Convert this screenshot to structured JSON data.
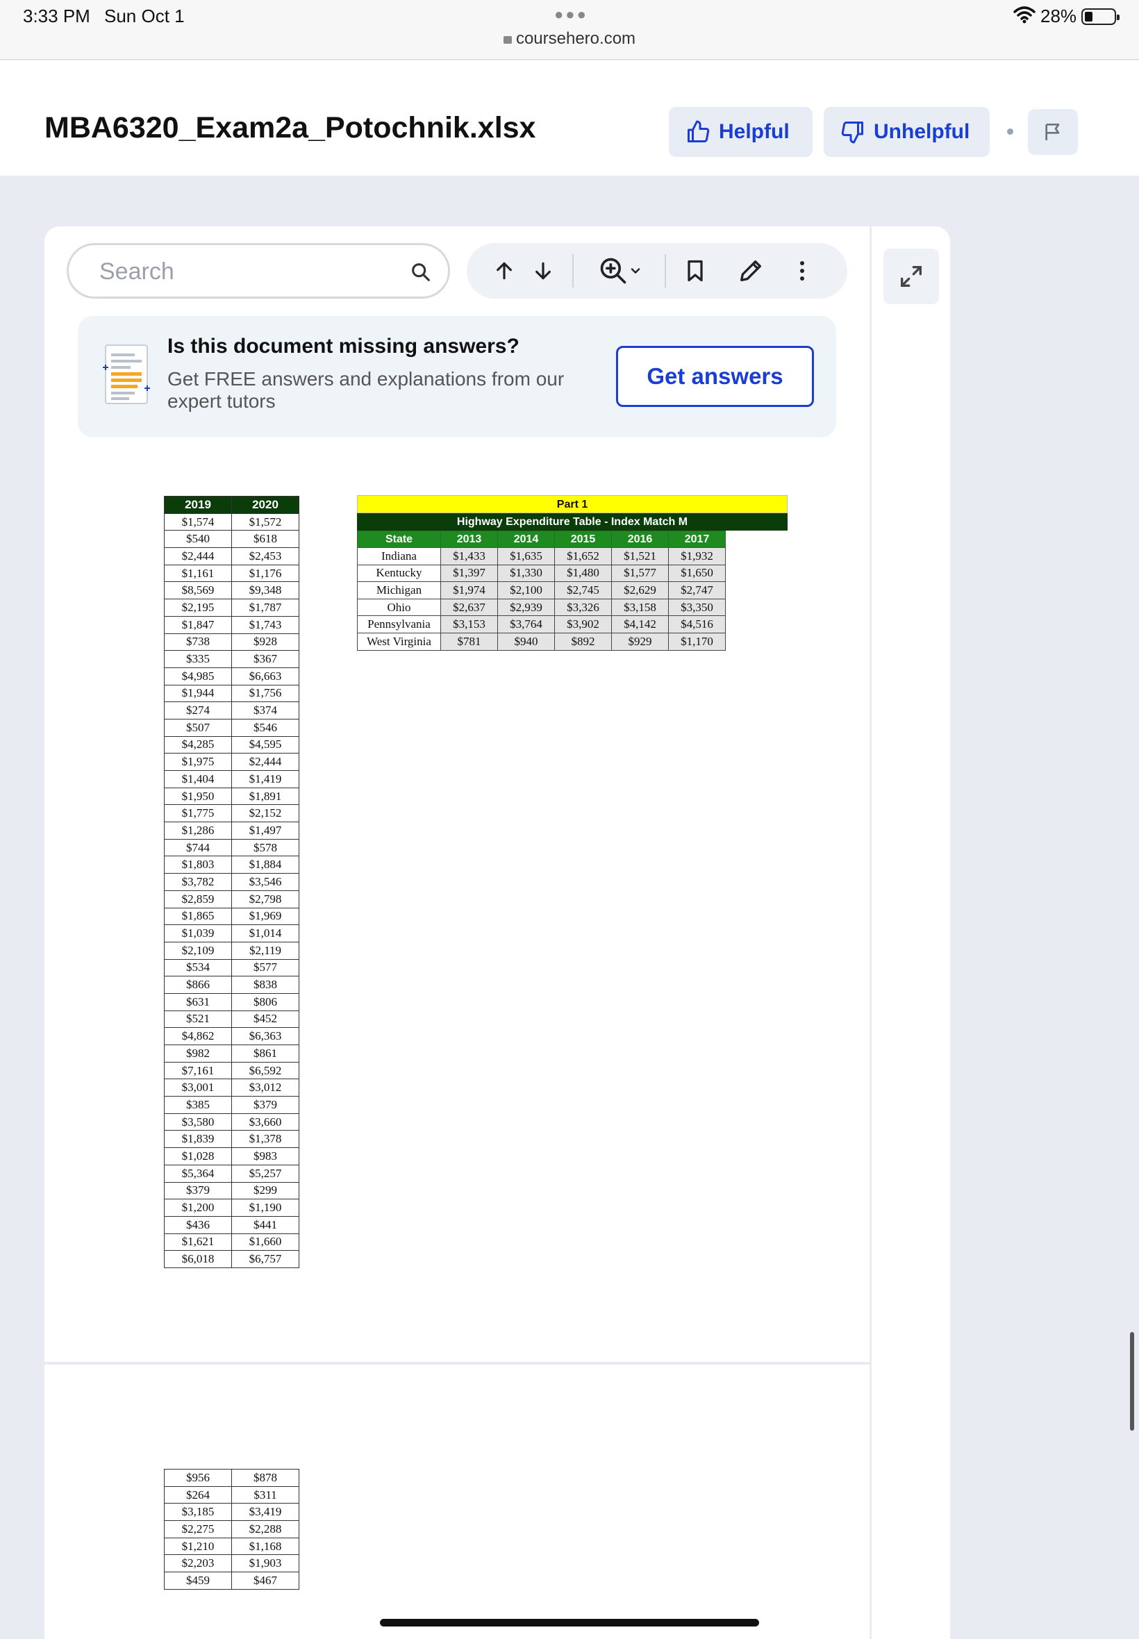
{
  "status_bar": {
    "time": "3:33 PM",
    "date": "Sun Oct 1",
    "url": "coursehero.com",
    "battery": "28%"
  },
  "header": {
    "title": "MBA6320_Exam2a_Potochnik.xlsx",
    "helpful": "Helpful",
    "unhelpful": "Unhelpful"
  },
  "search": {
    "placeholder": "Search"
  },
  "banner": {
    "title": "Is this document missing answers?",
    "text": "Get FREE answers and explanations from our expert tutors",
    "button": "Get answers"
  },
  "year_table": {
    "headers": [
      "2019",
      "2020"
    ],
    "rows": [
      [
        "$1,574",
        "$1,572"
      ],
      [
        "$540",
        "$618"
      ],
      [
        "$2,444",
        "$2,453"
      ],
      [
        "$1,161",
        "$1,176"
      ],
      [
        "$8,569",
        "$9,348"
      ],
      [
        "$2,195",
        "$1,787"
      ],
      [
        "$1,847",
        "$1,743"
      ],
      [
        "$738",
        "$928"
      ],
      [
        "$335",
        "$367"
      ],
      [
        "$4,985",
        "$6,663"
      ],
      [
        "$1,944",
        "$1,756"
      ],
      [
        "$274",
        "$374"
      ],
      [
        "$507",
        "$546"
      ],
      [
        "$4,285",
        "$4,595"
      ],
      [
        "$1,975",
        "$2,444"
      ],
      [
        "$1,404",
        "$1,419"
      ],
      [
        "$1,950",
        "$1,891"
      ],
      [
        "$1,775",
        "$2,152"
      ],
      [
        "$1,286",
        "$1,497"
      ],
      [
        "$744",
        "$578"
      ],
      [
        "$1,803",
        "$1,884"
      ],
      [
        "$3,782",
        "$3,546"
      ],
      [
        "$2,859",
        "$2,798"
      ],
      [
        "$1,865",
        "$1,969"
      ],
      [
        "$1,039",
        "$1,014"
      ],
      [
        "$2,109",
        "$2,119"
      ],
      [
        "$534",
        "$577"
      ],
      [
        "$866",
        "$838"
      ],
      [
        "$631",
        "$806"
      ],
      [
        "$521",
        "$452"
      ],
      [
        "$4,862",
        "$6,363"
      ],
      [
        "$982",
        "$861"
      ],
      [
        "$7,161",
        "$6,592"
      ],
      [
        "$3,001",
        "$3,012"
      ],
      [
        "$385",
        "$379"
      ],
      [
        "$3,580",
        "$3,660"
      ],
      [
        "$1,839",
        "$1,378"
      ],
      [
        "$1,028",
        "$983"
      ],
      [
        "$5,364",
        "$5,257"
      ],
      [
        "$379",
        "$299"
      ],
      [
        "$1,200",
        "$1,190"
      ],
      [
        "$436",
        "$441"
      ],
      [
        "$1,621",
        "$1,660"
      ],
      [
        "$6,018",
        "$6,757"
      ]
    ],
    "rows_page2": [
      [
        "$956",
        "$878"
      ],
      [
        "$264",
        "$311"
      ],
      [
        "$3,185",
        "$3,419"
      ],
      [
        "$2,275",
        "$2,288"
      ],
      [
        "$1,210",
        "$1,168"
      ],
      [
        "$2,203",
        "$1,903"
      ],
      [
        "$459",
        "$467"
      ]
    ]
  },
  "highway": {
    "part_label": "Part 1",
    "title": "Highway Expenditure Table - Index Match M",
    "headers": [
      "State",
      "2013",
      "2014",
      "2015",
      "2016",
      "2017"
    ],
    "rows": [
      [
        "Indiana",
        "$1,433",
        "$1,635",
        "$1,652",
        "$1,521",
        "$1,932"
      ],
      [
        "Kentucky",
        "$1,397",
        "$1,330",
        "$1,480",
        "$1,577",
        "$1,650"
      ],
      [
        "Michigan",
        "$1,974",
        "$2,100",
        "$2,745",
        "$2,629",
        "$2,747"
      ],
      [
        "Ohio",
        "$2,637",
        "$2,939",
        "$3,326",
        "$3,158",
        "$3,350"
      ],
      [
        "Pennsylvania",
        "$3,153",
        "$3,764",
        "$3,902",
        "$4,142",
        "$4,516"
      ],
      [
        "West Virginia",
        "$781",
        "$940",
        "$892",
        "$929",
        "$1,170"
      ]
    ]
  }
}
